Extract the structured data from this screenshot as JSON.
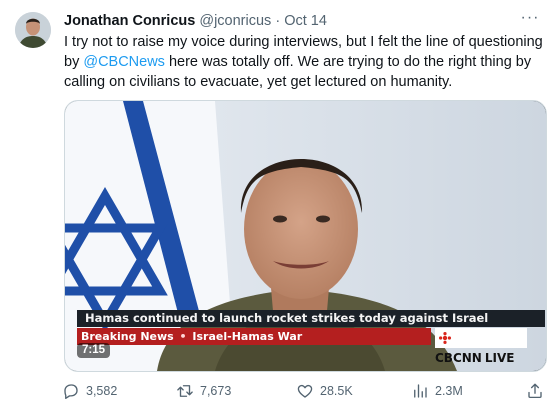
{
  "tweet": {
    "author_name": "Jonathan Conricus",
    "handle": "@jconricus",
    "separator": "·",
    "date": "Oct 14",
    "more_label": "···",
    "text_before_mention": "I try not to raise my voice during interviews, but I felt the line of questioning by ",
    "mention": "@CBCNews",
    "text_after_mention": " here was totally off. We are trying to do the right thing by calling on civilians to evacuate, yet get lectured on humanity."
  },
  "video": {
    "headline": "Hamas continued to launch rocket strikes today against Israel",
    "ticker_label": "Breaking News",
    "ticker_separator": "•",
    "ticker_topic": "Israel-Hamas War",
    "network": "CBCNN",
    "live_label": "LIVE",
    "duration": "7:15"
  },
  "actions": {
    "replies": "3,582",
    "retweets": "7,673",
    "likes": "28.5K",
    "views": "2.3M"
  },
  "colors": {
    "accent": "#1d9bf0",
    "muted": "#536471",
    "ticker_red": "#b41f1f",
    "flag_blue": "#1f4fa8"
  },
  "icons": [
    "reply-icon",
    "retweet-icon",
    "like-icon",
    "views-icon",
    "share-icon",
    "more-icon",
    "maple-gem-icon"
  ]
}
